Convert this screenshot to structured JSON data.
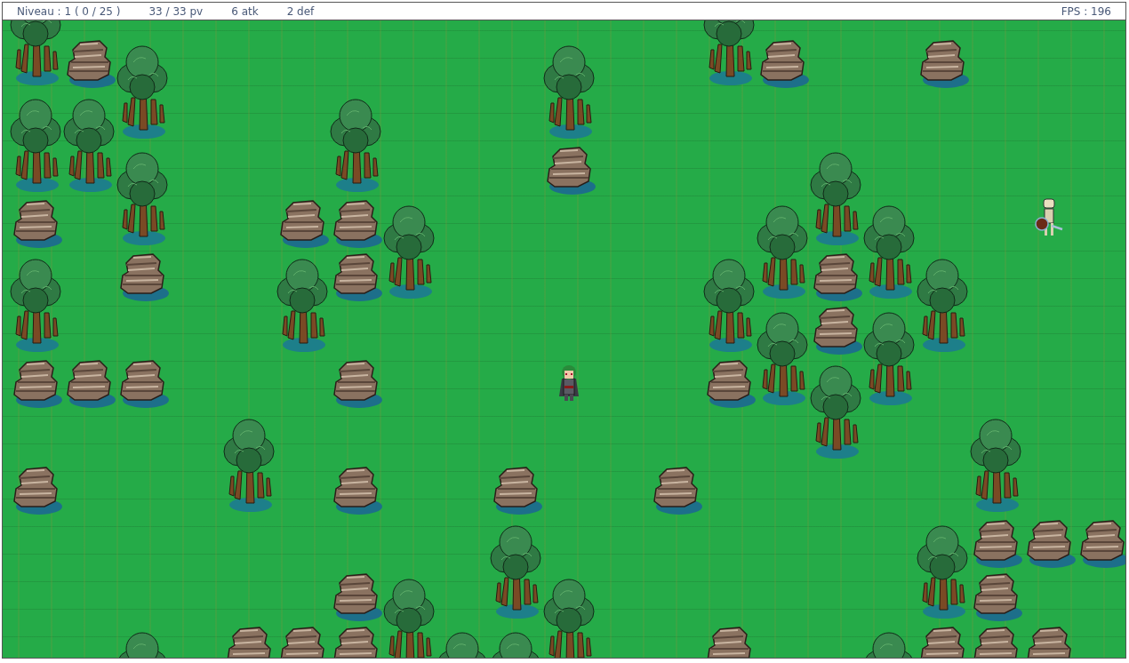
{
  "hud": {
    "level": "Niveau : 1 ( 0 / 25 )",
    "hp": "33 / 33 pv",
    "attack": "6 atk",
    "defense": "2 def",
    "fps": "FPS : 196"
  }
}
